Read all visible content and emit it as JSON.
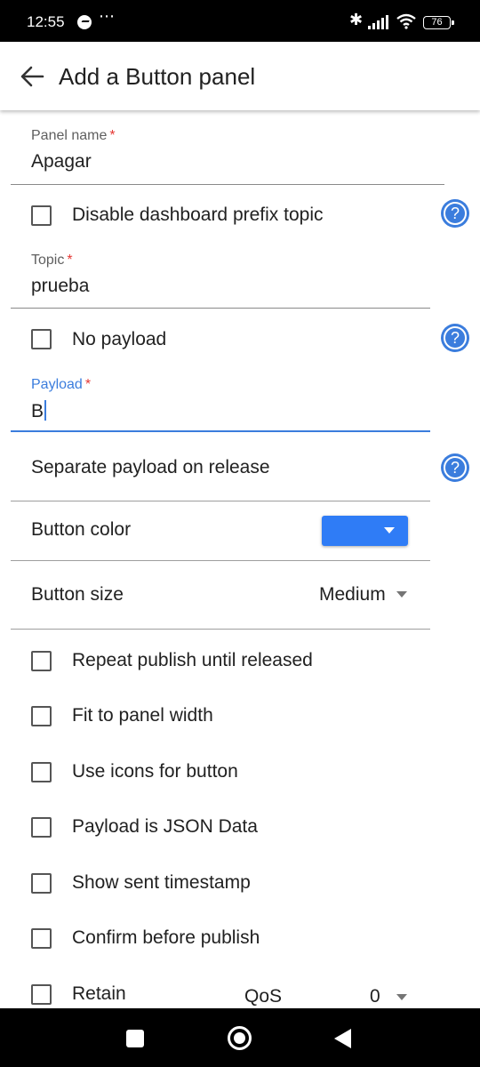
{
  "status_bar": {
    "time": "12:55",
    "more": "⋯",
    "battery": "76"
  },
  "app_bar": {
    "title": "Add a Button panel"
  },
  "form": {
    "panel_name": {
      "label": "Panel name",
      "required": "*",
      "value": "Apagar"
    },
    "disable_prefix": {
      "label": "Disable dashboard prefix topic",
      "checked": false,
      "help": "?"
    },
    "topic": {
      "label": "Topic",
      "required": "*",
      "value": "prueba"
    },
    "no_payload": {
      "label": "No payload",
      "checked": false,
      "help": "?"
    },
    "payload": {
      "label": "Payload",
      "required": "*",
      "value": "B"
    },
    "separate_payload": {
      "label": "Separate payload on release",
      "help": "?"
    },
    "button_color": {
      "label": "Button color",
      "value": "#2f7cf6"
    },
    "button_size": {
      "label": "Button size",
      "value": "Medium"
    },
    "options": [
      {
        "label": "Repeat publish until released",
        "checked": false
      },
      {
        "label": "Fit to panel width",
        "checked": false
      },
      {
        "label": "Use icons for button",
        "checked": false
      },
      {
        "label": "Payload is JSON Data",
        "checked": false
      },
      {
        "label": "Show sent timestamp",
        "checked": false
      },
      {
        "label": "Confirm before publish",
        "checked": false
      }
    ],
    "retain": {
      "label": "Retain",
      "checked": false
    },
    "qos": {
      "label": "QoS",
      "value": "0"
    }
  },
  "colors": {
    "accent": "#3b7ddd",
    "button_color_swatch": "#2f7cf6",
    "required": "#e53935"
  },
  "icons": {
    "back": "arrow-left-icon",
    "help": "help-circle-icon",
    "dropdown": "caret-down-icon"
  }
}
